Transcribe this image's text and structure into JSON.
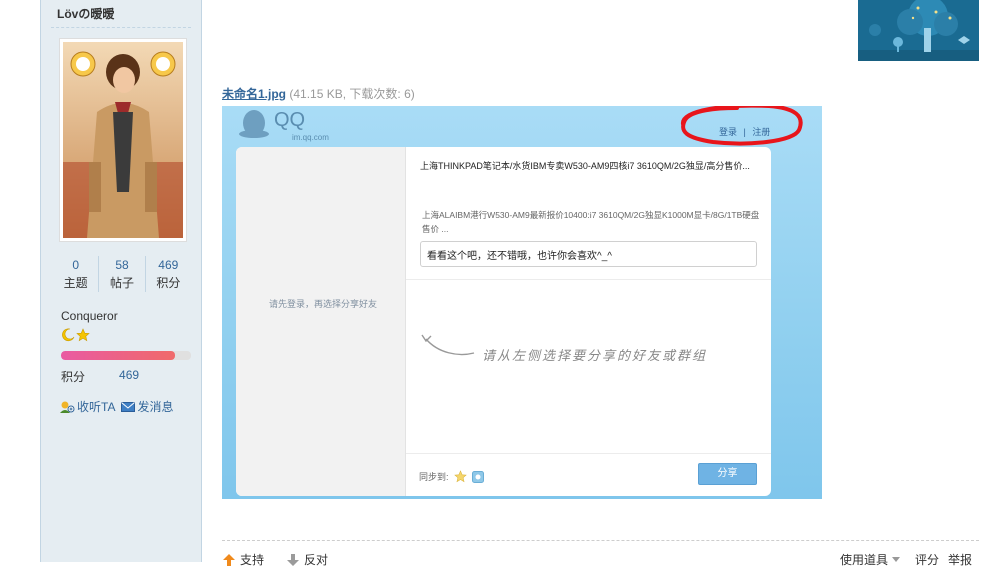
{
  "user": {
    "name": "Lövの暧暧",
    "stats": [
      {
        "value": "0",
        "label": "主题"
      },
      {
        "value": "58",
        "label": "帖子"
      },
      {
        "value": "469",
        "label": "积分"
      }
    ],
    "rank": "Conqueror",
    "rank_progress": 0.88,
    "credit_label": "积分",
    "credit_value": "469",
    "follow_label": "收听TA",
    "message_label": "发消息"
  },
  "attachment": {
    "filename": "未命名1.jpg",
    "meta": "(41.15 KB, 下载次数: 6)"
  },
  "qq_share": {
    "logo_text": "QQ",
    "logo_sub": "im.qq.com",
    "login": "登录",
    "divider": "|",
    "register": "注册",
    "left_hint": "请先登录，再选择分享好友",
    "title1": "上海THINKPAD笔记本/水货IBM专卖W530-AM9四核i7 3610QM/2G独显/高分售价...",
    "title2": "上海ALAIBM港行W530-AM9最新报价10400:i7 3610QM/2G独显K1000M显卡/8G/1TB硬盘售价 ...",
    "comment": "看看这个吧，还不错哦，也许你会喜欢^_^",
    "right_hint": "请从左侧选择要分享的好友或群组",
    "sync_label": "同步到:",
    "share_button": "分享"
  },
  "bottom": {
    "support": "支持",
    "oppose": "反对",
    "tools": "使用道具",
    "rate": "评分",
    "report": "举报"
  },
  "colors": {
    "sidebar_bg": "#e5edf2",
    "link": "#336699",
    "highlight_oval": "#e8151b",
    "share_button": "#6fb3e4"
  }
}
